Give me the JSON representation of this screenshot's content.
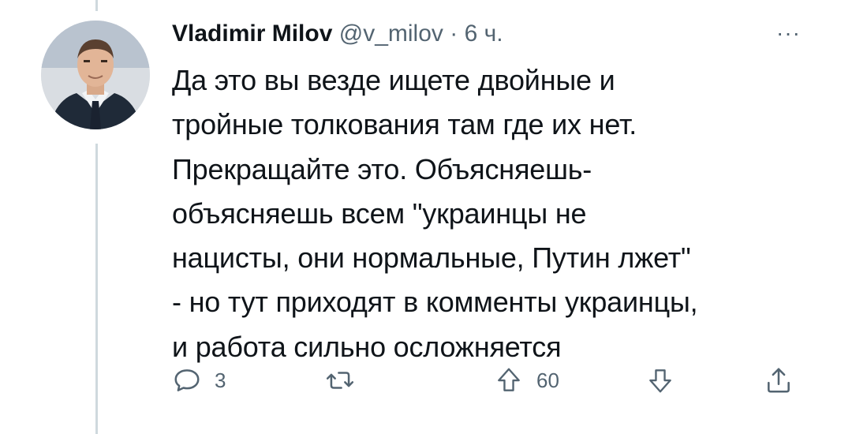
{
  "tweet": {
    "author_name": "Vladimir Milov",
    "author_handle": "@v_milov",
    "separator": "·",
    "timestamp": "6 ч.",
    "more_label": "···",
    "text_lines": [
      "Да это вы везде ищете двойные и",
      "тройные толкования там где их нет.",
      "Прекращайте это. Объясняешь-",
      "объясняешь всем \"украинцы не",
      "нацисты, они нормальные, Путин лжет\"",
      "- но тут приходят в комменты украинцы,",
      "и работа сильно осложняется"
    ]
  },
  "actions": {
    "reply_count": "3",
    "retweet_count": "",
    "upvote_count": "60",
    "downvote_count": "",
    "share_count": ""
  },
  "icons": {
    "reply": "speech-bubble-icon",
    "retweet": "retweet-icon",
    "upvote": "arrow-up-icon",
    "downvote": "arrow-down-icon",
    "share": "share-icon",
    "more": "more-dots-icon"
  },
  "colors": {
    "text": "#0f1419",
    "muted": "#536471",
    "thread_line": "#cfd9de",
    "background": "#ffffff"
  }
}
